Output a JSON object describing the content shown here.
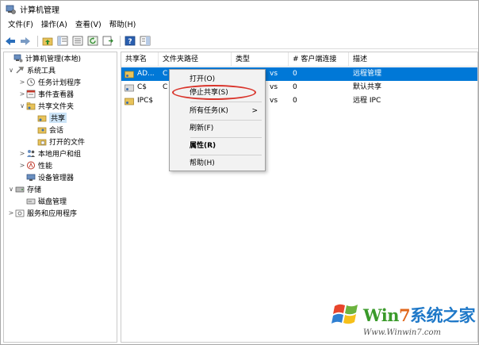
{
  "window": {
    "title": "计算机管理"
  },
  "menu": [
    {
      "label": "文件(F)"
    },
    {
      "label": "操作(A)"
    },
    {
      "label": "查看(V)"
    },
    {
      "label": "帮助(H)"
    }
  ],
  "toolbar": {
    "buttons": [
      {
        "icon": "back-arrow-icon"
      },
      {
        "icon": "forward-arrow-icon"
      },
      {
        "icon": "up-folder-icon"
      },
      {
        "icon": "show-hide-tree-icon"
      },
      {
        "icon": "properties-icon"
      },
      {
        "icon": "refresh-icon"
      },
      {
        "icon": "export-list-icon"
      },
      {
        "icon": "help-icon"
      },
      {
        "icon": "action-pane-icon"
      }
    ]
  },
  "tree": {
    "items": [
      {
        "label": "计算机管理(本地)",
        "indent": 0,
        "chevron": "",
        "icon": "computer-management-icon"
      },
      {
        "label": "系统工具",
        "indent": 1,
        "chevron": "∨",
        "icon": "tools-icon"
      },
      {
        "label": "任务计划程序",
        "indent": 2,
        "chevron": ">",
        "icon": "clock-icon"
      },
      {
        "label": "事件查看器",
        "indent": 2,
        "chevron": ">",
        "icon": "event-viewer-icon"
      },
      {
        "label": "共享文件夹",
        "indent": 2,
        "chevron": "∨",
        "icon": "shared-folder-icon"
      },
      {
        "label": "共享",
        "indent": 3,
        "chevron": "",
        "icon": "share-icon",
        "selected": true
      },
      {
        "label": "会话",
        "indent": 3,
        "chevron": "",
        "icon": "session-icon"
      },
      {
        "label": "打开的文件",
        "indent": 3,
        "chevron": "",
        "icon": "open-files-icon"
      },
      {
        "label": "本地用户和组",
        "indent": 2,
        "chevron": ">",
        "icon": "users-icon"
      },
      {
        "label": "性能",
        "indent": 2,
        "chevron": ">",
        "icon": "performance-icon"
      },
      {
        "label": "设备管理器",
        "indent": 2,
        "chevron": "",
        "icon": "device-manager-icon"
      },
      {
        "label": "存储",
        "indent": 1,
        "chevron": "∨",
        "icon": "storage-icon"
      },
      {
        "label": "磁盘管理",
        "indent": 2,
        "chevron": "",
        "icon": "disk-icon"
      },
      {
        "label": "服务和应用程序",
        "indent": 1,
        "chevron": ">",
        "icon": "services-icon"
      }
    ]
  },
  "list": {
    "columns": [
      {
        "label": "共享名"
      },
      {
        "label": "文件夹路径"
      },
      {
        "label": "类型"
      },
      {
        "label": "# 客户端连接"
      },
      {
        "label": "描述"
      }
    ],
    "rows": [
      {
        "name": "AD...",
        "path": "C",
        "type": "vs",
        "clients": "0",
        "desc": "远程管理",
        "selected": true
      },
      {
        "name": "C$",
        "path": "C",
        "type": "vs",
        "clients": "0",
        "desc": "默认共享"
      },
      {
        "name": "IPC$",
        "path": "",
        "type": "vs",
        "clients": "0",
        "desc": "远程 IPC"
      }
    ]
  },
  "context_menu": {
    "items": [
      {
        "label": "打开(O)"
      },
      {
        "label": "停止共享(S)",
        "highlighted": true
      },
      {
        "label": "所有任务(K)",
        "submenu": true
      },
      {
        "label": "刷新(F)"
      },
      {
        "label": "属性(R)",
        "bold": true
      },
      {
        "label": "帮助(H)"
      }
    ],
    "submenu_arrow": ">"
  },
  "watermark": {
    "text_win": "Win",
    "text_num": "7",
    "text_rest": "系统之家",
    "url": "Www.Winwin7.com"
  },
  "colors": {
    "selection": "#0078d7",
    "tree_selection": "#cce4f7",
    "annotation": "#d9342b"
  }
}
